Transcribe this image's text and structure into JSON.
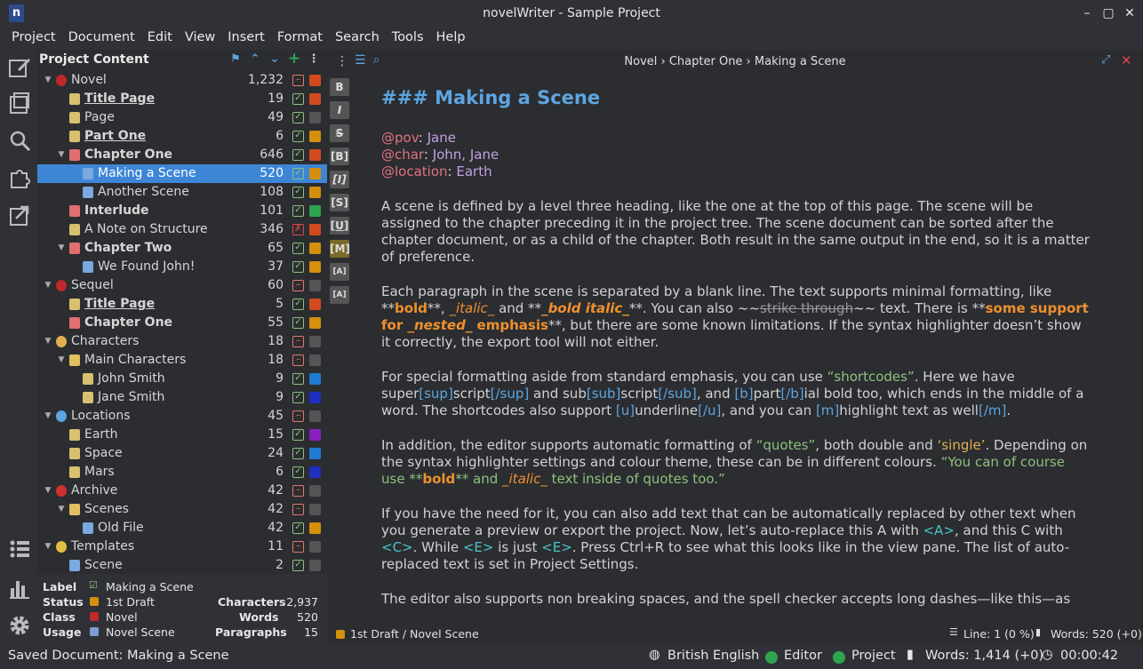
{
  "window": {
    "title": "novelWriter - Sample Project",
    "logo": "n"
  },
  "menu": [
    "Project",
    "Document",
    "Edit",
    "View",
    "Insert",
    "Format",
    "Search",
    "Tools",
    "Help"
  ],
  "tree": {
    "title": "Project Content",
    "rows": [
      {
        "label": "Novel",
        "count": "1,232",
        "depth": 0,
        "arrow": "open",
        "icon": "root-red",
        "bold": false,
        "ul": false,
        "check": "minus",
        "status": "#d24b1f"
      },
      {
        "label": "Title Page",
        "count": "19",
        "depth": 1,
        "arrow": "",
        "icon": "doc-yellow",
        "bold": true,
        "ul": true,
        "check": "ok",
        "status": "#d24b1f"
      },
      {
        "label": "Page",
        "count": "49",
        "depth": 1,
        "arrow": "",
        "icon": "doc-yellow",
        "bold": false,
        "ul": false,
        "check": "ok",
        "status": "#555"
      },
      {
        "label": "Part One",
        "count": "6",
        "depth": 1,
        "arrow": "",
        "icon": "doc-yellow",
        "bold": true,
        "ul": true,
        "check": "ok",
        "status": "#d4900c"
      },
      {
        "label": "Chapter One",
        "count": "646",
        "depth": 1,
        "arrow": "open",
        "icon": "doc-red",
        "bold": true,
        "ul": false,
        "check": "ok",
        "status": "#d24b1f"
      },
      {
        "label": "Making a Scene",
        "count": "520",
        "depth": 2,
        "arrow": "",
        "icon": "doc-blue",
        "bold": false,
        "ul": false,
        "check": "ok",
        "status": "#d4900c",
        "selected": true
      },
      {
        "label": "Another Scene",
        "count": "108",
        "depth": 2,
        "arrow": "",
        "icon": "doc-blue",
        "bold": false,
        "ul": false,
        "check": "ok",
        "status": "#d4900c"
      },
      {
        "label": "Interlude",
        "count": "101",
        "depth": 1,
        "arrow": "",
        "icon": "doc-red",
        "bold": true,
        "ul": false,
        "check": "ok",
        "status": "#2ea44f"
      },
      {
        "label": "A Note on Structure",
        "count": "346",
        "depth": 1,
        "arrow": "",
        "icon": "doc-yellow",
        "bold": false,
        "ul": false,
        "check": "flag",
        "status": "#d24b1f"
      },
      {
        "label": "Chapter Two",
        "count": "65",
        "depth": 1,
        "arrow": "open",
        "icon": "doc-red",
        "bold": true,
        "ul": false,
        "check": "ok",
        "status": "#d4900c"
      },
      {
        "label": "We Found John!",
        "count": "37",
        "depth": 2,
        "arrow": "",
        "icon": "doc-blue",
        "bold": false,
        "ul": false,
        "check": "ok",
        "status": "#d4900c"
      },
      {
        "label": "Sequel",
        "count": "60",
        "depth": 0,
        "arrow": "open",
        "icon": "root-red",
        "bold": false,
        "ul": false,
        "check": "minus",
        "status": "#555"
      },
      {
        "label": "Title Page",
        "count": "5",
        "depth": 1,
        "arrow": "",
        "icon": "doc-yellow",
        "bold": true,
        "ul": true,
        "check": "ok",
        "status": "#d24b1f"
      },
      {
        "label": "Chapter One",
        "count": "55",
        "depth": 1,
        "arrow": "",
        "icon": "doc-red",
        "bold": true,
        "ul": false,
        "check": "ok",
        "status": "#d4900c"
      },
      {
        "label": "Characters",
        "count": "18",
        "depth": 0,
        "arrow": "open",
        "icon": "root-person",
        "bold": false,
        "ul": false,
        "check": "minus",
        "status": "#555"
      },
      {
        "label": "Main Characters",
        "count": "18",
        "depth": 1,
        "arrow": "open",
        "icon": "folder",
        "bold": false,
        "ul": false,
        "check": "minus",
        "status": "#555"
      },
      {
        "label": "John Smith",
        "count": "9",
        "depth": 2,
        "arrow": "",
        "icon": "doc-yellow",
        "bold": false,
        "ul": false,
        "check": "ok",
        "status": "#1f7bd0"
      },
      {
        "label": "Jane Smith",
        "count": "9",
        "depth": 2,
        "arrow": "",
        "icon": "doc-yellow",
        "bold": false,
        "ul": false,
        "check": "ok",
        "status": "#1f2fc0"
      },
      {
        "label": "Locations",
        "count": "45",
        "depth": 0,
        "arrow": "open",
        "icon": "root-pin",
        "bold": false,
        "ul": false,
        "check": "minus",
        "status": "#555"
      },
      {
        "label": "Earth",
        "count": "15",
        "depth": 1,
        "arrow": "",
        "icon": "doc-yellow",
        "bold": false,
        "ul": false,
        "check": "ok",
        "status": "#8a1fc0"
      },
      {
        "label": "Space",
        "count": "24",
        "depth": 1,
        "arrow": "",
        "icon": "doc-yellow",
        "bold": false,
        "ul": false,
        "check": "ok",
        "status": "#1f7bd0"
      },
      {
        "label": "Mars",
        "count": "6",
        "depth": 1,
        "arrow": "",
        "icon": "doc-yellow",
        "bold": false,
        "ul": false,
        "check": "ok",
        "status": "#1f2fc0"
      },
      {
        "label": "Archive",
        "count": "42",
        "depth": 0,
        "arrow": "open",
        "icon": "root-archive",
        "bold": false,
        "ul": false,
        "check": "minus",
        "status": "#555"
      },
      {
        "label": "Scenes",
        "count": "42",
        "depth": 1,
        "arrow": "open",
        "icon": "folder",
        "bold": false,
        "ul": false,
        "check": "minus",
        "status": "#555"
      },
      {
        "label": "Old File",
        "count": "42",
        "depth": 2,
        "arrow": "",
        "icon": "doc-blue",
        "bold": false,
        "ul": false,
        "check": "ok",
        "status": "#d4900c"
      },
      {
        "label": "Templates",
        "count": "11",
        "depth": 0,
        "arrow": "open",
        "icon": "root-star",
        "bold": false,
        "ul": false,
        "check": "minus",
        "status": "#555"
      },
      {
        "label": "Scene",
        "count": "2",
        "depth": 1,
        "arrow": "",
        "icon": "doc-blue",
        "bold": false,
        "ul": false,
        "check": "ok",
        "status": "#555"
      }
    ]
  },
  "details": {
    "label_key": "Label",
    "label_val": "Making a Scene",
    "status_key": "Status",
    "status_val": "1st Draft",
    "class_key": "Class",
    "class_val": "Novel",
    "usage_key": "Usage",
    "usage_val": "Novel Scene",
    "chars_key": "Characters",
    "chars_val": "2,937",
    "words_key": "Words",
    "words_val": "520",
    "paras_key": "Paragraphs",
    "paras_val": "15"
  },
  "editor": {
    "crumb": "Novel › Chapter One › Making a Scene",
    "footer_status": "1st Draft / Novel Scene",
    "footer_line": "Line: 1 (0 %)",
    "footer_words": "Words: 520 (+0)"
  },
  "statusbar": {
    "message": "Saved Document: Making a Scene",
    "language": "British English",
    "editor": "Editor",
    "project": "Project",
    "words": "Words: 1,414 (+0)",
    "time": "00:00:42"
  },
  "colors": {
    "accent": "#3d86d6",
    "heading": "#5ca5e0",
    "emphasis": "#f0902c",
    "quote": "#8ec07c"
  }
}
